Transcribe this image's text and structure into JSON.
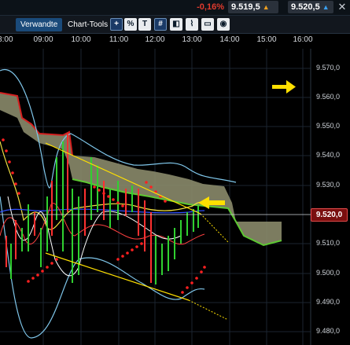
{
  "header": {
    "change_pct": "-0,16%",
    "quote1": "9.519,5",
    "quote2": "9.520,5"
  },
  "toolbar": {
    "tab_related": "Verwandte",
    "tab_tools": "Chart-Tools",
    "buttons": [
      "+",
      "%",
      "TT",
      "#",
      "candles",
      "lines",
      "print",
      "screen"
    ]
  },
  "time_axis": {
    "ticks": [
      "08:00",
      "09:00",
      "10:00",
      "11:00",
      "12:00",
      "13:00",
      "14:00",
      "15:00",
      "16:00"
    ]
  },
  "price_axis": {
    "ticks": [
      "9.570,0",
      "9.560,0",
      "9.550,0",
      "9.540,0",
      "9.530,0",
      "9.520,0",
      "9.510,0",
      "9.500,0",
      "9.490,0",
      "9.480,0"
    ],
    "current_price": "9.520,0"
  },
  "colors": {
    "current_price_bg": "#7a0f0f",
    "annotation_arrow": "#ffe000",
    "cloud": "#8a8a6a",
    "cloud_edge_red": "#d42020",
    "cloud_edge_green": "#5dc832"
  }
}
